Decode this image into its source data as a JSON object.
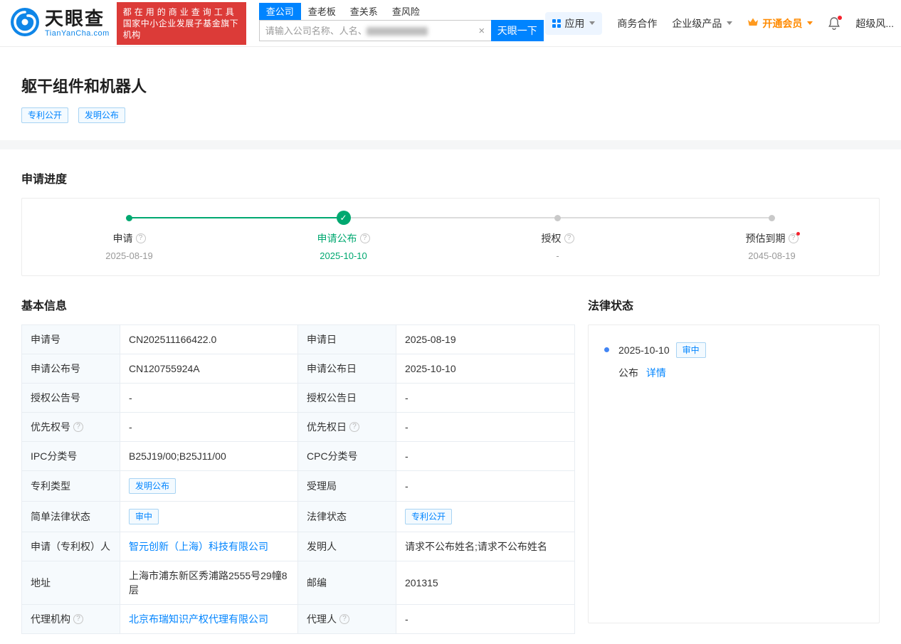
{
  "icons": {
    "help": "?",
    "clear": "×",
    "check": "✓"
  },
  "header": {
    "logo": {
      "brand": "天眼查",
      "domain": "TianYanCha.com"
    },
    "banner": {
      "line1": "都在用的商业查询工具",
      "line2": "国家中小企业发展子基金旗下机构"
    },
    "search": {
      "tabs": [
        {
          "label": "查公司",
          "active": true
        },
        {
          "label": "查老板",
          "active": false
        },
        {
          "label": "查关系",
          "active": false
        },
        {
          "label": "查风险",
          "active": false
        }
      ],
      "placeholder": "请输入公司名称、人名、",
      "button": "天眼一下"
    },
    "nav": {
      "app": "应用",
      "business": "商务合作",
      "enterprise": "企业级产品",
      "vip": "开通会员",
      "super_risk": "超级风..."
    }
  },
  "patent": {
    "title": "躯干组件和机器人",
    "tags": [
      "专利公开",
      "发明公布"
    ]
  },
  "progress": {
    "heading": "申请进度",
    "steps": [
      {
        "label": "申请",
        "date": "2025-08-19"
      },
      {
        "label": "申请公布",
        "date": "2025-10-10"
      },
      {
        "label": "授权",
        "date": "-"
      },
      {
        "label": "预估到期",
        "date": "2045-08-19"
      }
    ]
  },
  "basic": {
    "heading": "基本信息",
    "rows": [
      {
        "l1": "申请号",
        "v1": "CN202511166422.0",
        "l2": "申请日",
        "v2": "2025-08-19"
      },
      {
        "l1": "申请公布号",
        "v1": "CN120755924A",
        "l2": "申请公布日",
        "v2": "2025-10-10"
      },
      {
        "l1": "授权公告号",
        "v1": "-",
        "l2": "授权公告日",
        "v2": "-"
      },
      {
        "l1": "优先权号",
        "v1": "-",
        "l2": "优先权日",
        "v2": "-"
      },
      {
        "l1": "IPC分类号",
        "v1": "B25J19/00;B25J11/00",
        "l2": "CPC分类号",
        "v2": "-"
      },
      {
        "l1": "专利类型",
        "v1": "发明公布",
        "l2": "受理局",
        "v2": "-"
      },
      {
        "l1": "简单法律状态",
        "v1": "审中",
        "l2": "法律状态",
        "v2": "专利公开"
      },
      {
        "l1": "申请（专利权）人",
        "v1": "智元创新（上海）科技有限公司",
        "l2": "发明人",
        "v2": "请求不公布姓名;请求不公布姓名"
      },
      {
        "l1": "地址",
        "v1": "上海市浦东新区秀浦路2555号29幢8层",
        "l2": "邮编",
        "v2": "201315"
      },
      {
        "l1": "代理机构",
        "v1": "北京布瑞知识产权代理有限公司",
        "l2": "代理人",
        "v2": "-"
      }
    ]
  },
  "legal": {
    "heading": "法律状态",
    "items": [
      {
        "date": "2025-10-10",
        "status": "审中",
        "event": "公布",
        "detail": "详情"
      }
    ]
  }
}
